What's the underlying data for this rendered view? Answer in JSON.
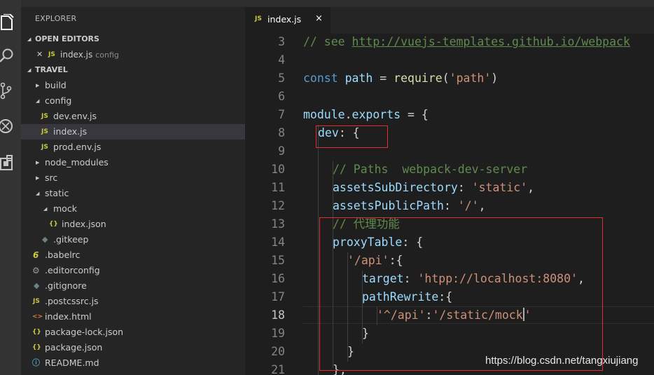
{
  "sidebar": {
    "title": "EXPLORER",
    "open_editors": {
      "header": "OPEN EDITORS",
      "items": [
        {
          "icon": "JS",
          "name": "index.js",
          "dir": "config"
        }
      ]
    },
    "folder": {
      "header": "TRAVEL",
      "rows": [
        {
          "name": "build",
          "icon": "chevron-right-icon"
        },
        {
          "name": "config",
          "icon": "chevron-down-icon"
        },
        {
          "name": "dev.env.js",
          "icon": "JS"
        },
        {
          "name": "index.js",
          "icon": "JS"
        },
        {
          "name": "prod.env.js",
          "icon": "JS"
        },
        {
          "name": "node_modules",
          "icon": "chevron-right-icon"
        },
        {
          "name": "src",
          "icon": "chevron-right-icon"
        },
        {
          "name": "static",
          "icon": "chevron-down-icon"
        },
        {
          "name": "mock",
          "icon": "chevron-down-icon"
        },
        {
          "name": "index.json",
          "icon": "{}"
        },
        {
          "name": ".gitkeep",
          "icon": "diamond-icon"
        },
        {
          "name": ".babelrc",
          "icon": "6"
        },
        {
          "name": ".editorconfig",
          "icon": "gear-icon"
        },
        {
          "name": ".gitignore",
          "icon": "diamond-icon"
        },
        {
          "name": ".postcssrc.js",
          "icon": "JS"
        },
        {
          "name": "index.html",
          "icon": "<>"
        },
        {
          "name": "package-lock.json",
          "icon": "{}"
        },
        {
          "name": "package.json",
          "icon": "{}"
        },
        {
          "name": "README.md",
          "icon": "info-icon"
        }
      ]
    }
  },
  "tab": {
    "icon": "JS",
    "name": "index.js",
    "close": "×"
  },
  "editor": {
    "line_numbers": [
      "3",
      "4",
      "5",
      "6",
      "7",
      "8",
      "9",
      "10",
      "11",
      "12",
      "13",
      "14",
      "15",
      "16",
      "17",
      "18",
      "19",
      "20",
      "21"
    ],
    "active_line": "18",
    "lines": [
      [
        "// see ",
        "http://vuejs-templates.github.io/webpack"
      ],
      [],
      [
        "const",
        " ",
        "path",
        " = ",
        "require",
        "(",
        "'path'",
        ")"
      ],
      [],
      [
        "module",
        ".",
        "exports",
        " = {"
      ],
      [
        "dev",
        ": {"
      ],
      [],
      [
        "// Paths  webpack-dev-server"
      ],
      [
        "assetsSubDirectory",
        ": ",
        "'static'",
        ","
      ],
      [
        "assetsPublicPath",
        ": ",
        "'/'",
        ","
      ],
      [
        "// 代理功能"
      ],
      [
        "proxyTable",
        ": {"
      ],
      [
        "'/api'",
        ":{"
      ],
      [
        "target",
        ": ",
        "'htpp://localhost:8080'",
        ","
      ],
      [
        "pathRewrite",
        ":{"
      ],
      [
        "'^/api'",
        ":",
        "'/static/mock",
        "'"
      ],
      [
        "}"
      ],
      [
        "}"
      ],
      [
        "},"
      ]
    ]
  },
  "colors": {
    "highlight_box": "#e03030",
    "comment": "#608b4e",
    "keyword": "#569cd6",
    "string": "#ce9178",
    "property": "#9cdcfe",
    "function": "#dcdcaa"
  },
  "watermark": "https://blog.csdn.net/tangxiujiang"
}
